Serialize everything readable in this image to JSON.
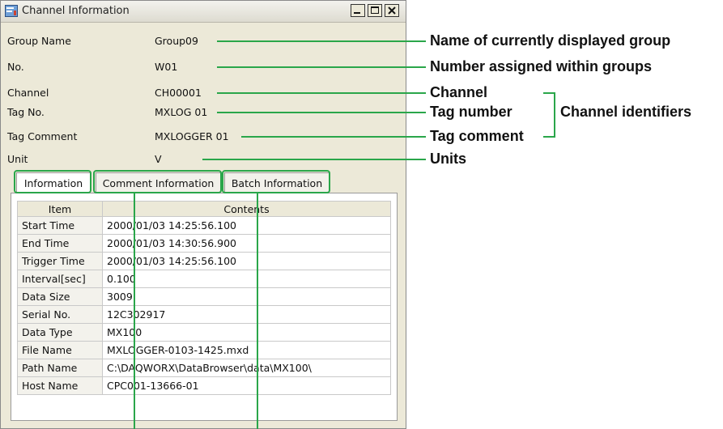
{
  "window": {
    "title": "Channel Information",
    "controls": {
      "minimize": "_",
      "maximize": "□",
      "close": "×"
    }
  },
  "fields": [
    {
      "label": "Group Name",
      "value": "Group09"
    },
    {
      "label": "No.",
      "value": "W01"
    },
    {
      "label": "Channel",
      "value": "CH00001"
    },
    {
      "label": "Tag No.",
      "value": "MXLOG 01"
    },
    {
      "label": "Tag Comment",
      "value": "MXLOGGER 01"
    },
    {
      "label": "Unit",
      "value": "V"
    }
  ],
  "tabs": [
    "Information",
    "Comment Information",
    "Batch Information"
  ],
  "table": {
    "headers": {
      "item": "Item",
      "contents": "Contents"
    },
    "rows": [
      {
        "item": "Start Time",
        "value": "2000/01/03 14:25:56.100"
      },
      {
        "item": "End Time",
        "value": "2000/01/03 14:30:56.900"
      },
      {
        "item": "Trigger Time",
        "value": "2000/01/03 14:25:56.100"
      },
      {
        "item": "Interval[sec]",
        "value": "0.100"
      },
      {
        "item": "Data Size",
        "value": "3009"
      },
      {
        "item": "Serial No.",
        "value": "12C302917"
      },
      {
        "item": "Data Type",
        "value": "MX100"
      },
      {
        "item": "File Name",
        "value": "MXLOGGER-0103-1425.mxd"
      },
      {
        "item": "Path Name",
        "value": "C:\\DAQWORX\\DataBrowser\\data\\MX100\\"
      },
      {
        "item": "Host Name",
        "value": "CPC001-13666-01"
      }
    ]
  },
  "annotations": {
    "group_name": "Name of currently displayed group",
    "number": "Number assigned within groups",
    "channel": "Channel",
    "tag_number": "Tag number",
    "tag_comment": "Tag comment",
    "units": "Units",
    "channel_identifiers": "Channel identifiers"
  },
  "colors": {
    "callout_line": "#2aa64a",
    "window_bg": "#ece9d8"
  }
}
